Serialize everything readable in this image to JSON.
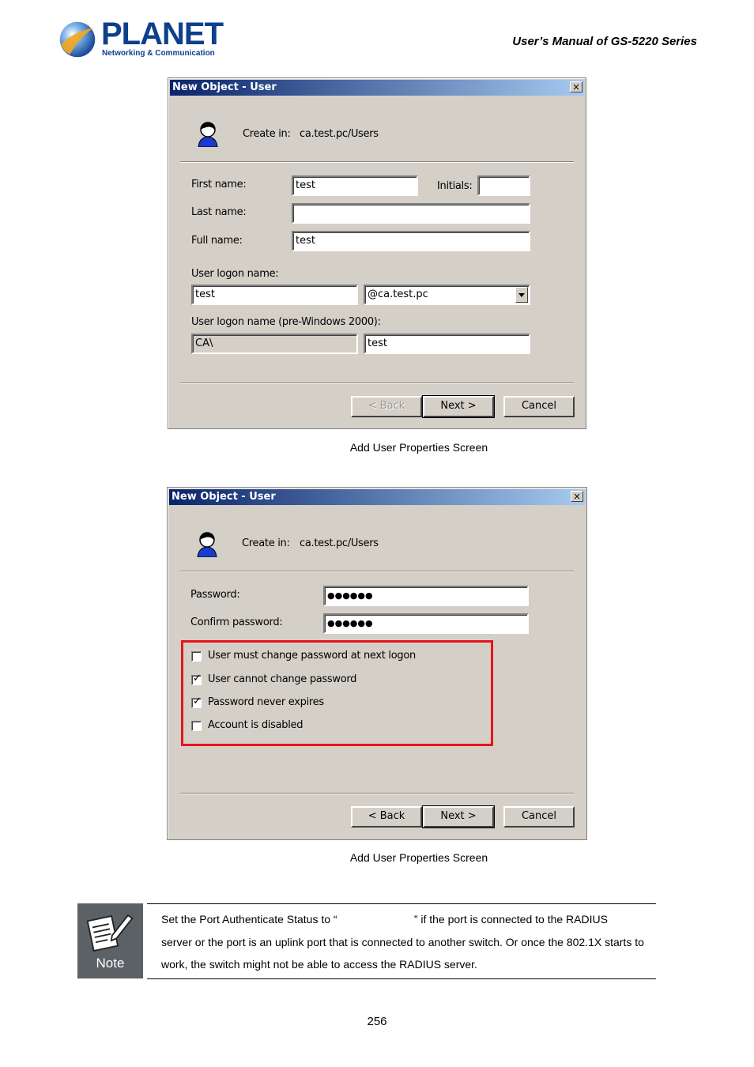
{
  "header": {
    "logo_word": "PLANET",
    "logo_sub": "Networking & Communication",
    "manual_title": "User’s  Manual  of  GS-5220  Series"
  },
  "dialog1": {
    "title": "New Object - User",
    "close": "×",
    "create_in_label": "Create in:",
    "create_in_value": "ca.test.pc/Users",
    "first_name_label": "First name:",
    "first_name_value": "test",
    "initials_label": "Initials:",
    "initials_value": "",
    "last_name_label": "Last name:",
    "last_name_value": "",
    "full_name_label": "Full name:",
    "full_name_value": "test",
    "logon_label": "User logon name:",
    "logon_value": "test",
    "domain_value": "@ca.test.pc",
    "pre2000_label": "User logon name (pre-Windows 2000):",
    "pre2000_domain": "CA\\",
    "pre2000_value": "test",
    "back_label": "< Back",
    "next_label": "Next >",
    "cancel_label": "Cancel"
  },
  "caption1": "Add User Properties Screen",
  "dialog2": {
    "title": "New Object - User",
    "close": "×",
    "create_in_label": "Create in:",
    "create_in_value": "ca.test.pc/Users",
    "password_label": "Password:",
    "password_value": "●●●●●●",
    "confirm_label": "Confirm password:",
    "confirm_value": "●●●●●●",
    "options": [
      {
        "label": "User must change password at next logon",
        "checked": false
      },
      {
        "label": "User cannot change password",
        "checked": true
      },
      {
        "label": "Password never expires",
        "checked": true
      },
      {
        "label": "Account is disabled",
        "checked": false
      }
    ],
    "check_mark": "✓",
    "back_label": "< Back",
    "next_label": "Next >",
    "cancel_label": "Cancel"
  },
  "caption2": "Add User Properties Screen",
  "note": {
    "icon_label": "Note",
    "line1": "Set the Port Authenticate Status to “                         ” if the port is connected to the RADIUS",
    "line2": "server or the port is an uplink port that is connected to another switch. Or once the 802.1X starts to",
    "line3": "work, the switch might not be able to access the RADIUS server."
  },
  "page_number": "256",
  "colors": {
    "highlight_box": "#e8141c",
    "title_bar": "#0a246a",
    "logo_blue": "#0e3f8c"
  }
}
